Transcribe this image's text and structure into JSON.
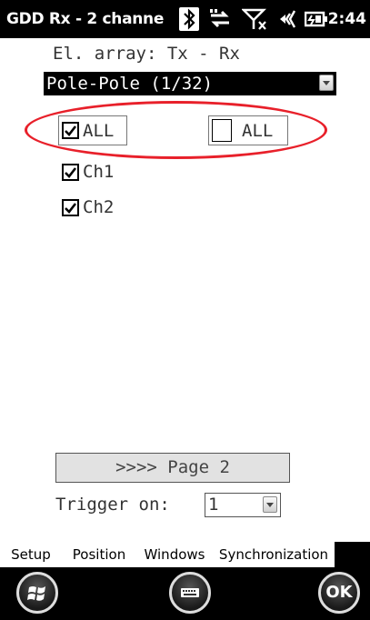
{
  "titlebar": {
    "title": "GDD Rx - 2 channe",
    "time": "2:44",
    "icons": [
      "bluetooth-icon",
      "data-sync-icon",
      "no-signal-icon",
      "volume-icon",
      "battery-icon"
    ]
  },
  "config": {
    "array_label": "El. array: Tx - Rx",
    "array_value": "Pole-Pole (1/32)"
  },
  "channels": {
    "all_tx": {
      "label": "ALL",
      "checked": true
    },
    "all_rx": {
      "label": "ALL",
      "checked": false
    },
    "items": [
      {
        "label": "Ch1",
        "checked": true
      },
      {
        "label": "Ch2",
        "checked": true
      }
    ]
  },
  "page_button": ">>>> Page 2",
  "trigger": {
    "label": "Trigger on:",
    "value": "1"
  },
  "tabs": [
    {
      "label": "Setup",
      "active": true
    },
    {
      "label": "Position",
      "active": false
    },
    {
      "label": "Windows",
      "active": false
    },
    {
      "label": "Synchronization",
      "active": false
    }
  ],
  "softkeys": {
    "start": "windows-start-icon",
    "keyboard": "keyboard-icon",
    "ok_label": "OK"
  },
  "colors": {
    "highlight": "#e8202a",
    "bar": "#000000"
  }
}
